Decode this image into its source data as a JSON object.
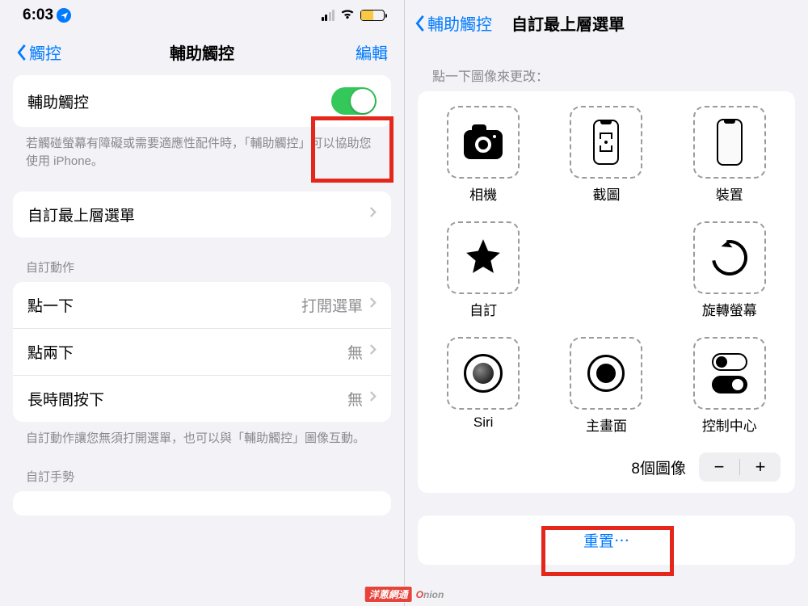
{
  "left": {
    "status": {
      "time": "6:03"
    },
    "nav": {
      "back": "觸控",
      "title": "輔助觸控",
      "edit": "編輯"
    },
    "switchRow": {
      "label": "輔助觸控"
    },
    "switchHint": "若觸碰螢幕有障礙或需要適應性配件時，「輔助觸控」可以協助您使用 iPhone。",
    "customMenu": "自訂最上層選單",
    "customActionsHeader": "自訂動作",
    "actions": {
      "tap": {
        "label": "點一下",
        "value": "打開選單"
      },
      "double": {
        "label": "點兩下",
        "value": "無"
      },
      "long": {
        "label": "長時間按下",
        "value": "無"
      }
    },
    "actionsHint": "自訂動作讓您無須打開選單，也可以與「輔助觸控」圖像互動。",
    "gesturesHeader": "自訂手勢"
  },
  "right": {
    "nav": {
      "back": "輔助觸控",
      "title": "自訂最上層選單"
    },
    "caption": "點一下圖像來更改：",
    "slots": {
      "camera": "相機",
      "screenshot": "截圖",
      "device": "裝置",
      "custom": "自訂",
      "rotate": "旋轉螢幕",
      "siri": "Siri",
      "home": "主畫面",
      "control": "控制中心"
    },
    "countLabel": "8個圖像",
    "reset": "重置⋯"
  }
}
